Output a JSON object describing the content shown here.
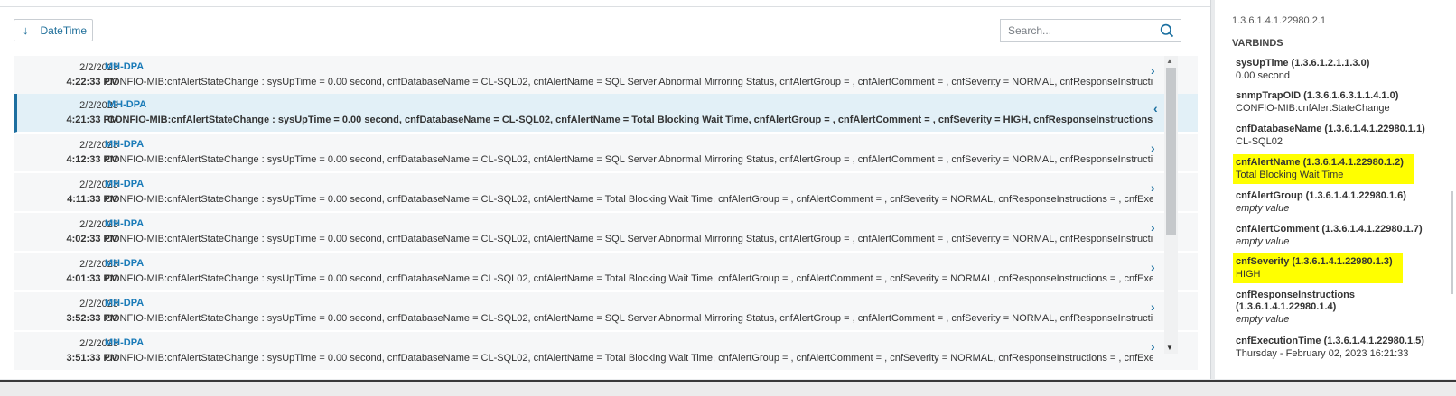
{
  "toolbar": {
    "sort_label": "DateTime",
    "sort_icon": "arrow-down-icon",
    "search_placeholder": "Search...",
    "search_icon": "search-icon"
  },
  "rows": [
    {
      "date": "2/2/2023",
      "time": "4:22:33 PM",
      "source": "MH-DPA",
      "message": "CONFIO-MIB:cnfAlertStateChange : sysUpTime = 0.00 second, cnfDatabaseName = CL-SQL02, cnfAlertName = SQL Server Abnormal Mirroring Status, cnfAlertGroup = , cnfAlertComment = , cnfSeverity = NORMAL, cnfResponseInstructions",
      "chevron": "›",
      "selected": false
    },
    {
      "date": "2/2/2023",
      "time": "4:21:33 PM",
      "source": "MH-DPA",
      "message": "CONFIO-MIB:cnfAlertStateChange : sysUpTime = 0.00 second, cnfDatabaseName = CL-SQL02, cnfAlertName = Total Blocking Wait Time, cnfAlertGroup = , cnfAlertComment = , cnfSeverity = HIGH, cnfResponseInstructions = ,",
      "chevron": "‹",
      "selected": true
    },
    {
      "date": "2/2/2023",
      "time": "4:12:33 PM",
      "source": "MH-DPA",
      "message": "CONFIO-MIB:cnfAlertStateChange : sysUpTime = 0.00 second, cnfDatabaseName = CL-SQL02, cnfAlertName = SQL Server Abnormal Mirroring Status, cnfAlertGroup = , cnfAlertComment = , cnfSeverity = NORMAL, cnfResponseInstructions",
      "chevron": "›",
      "selected": false
    },
    {
      "date": "2/2/2023",
      "time": "4:11:33 PM",
      "source": "MH-DPA",
      "message": "CONFIO-MIB:cnfAlertStateChange : sysUpTime = 0.00 second, cnfDatabaseName = CL-SQL02, cnfAlertName = Total Blocking Wait Time, cnfAlertGroup = , cnfAlertComment = , cnfSeverity = NORMAL, cnfResponseInstructions = , cnfExecutio",
      "chevron": "›",
      "selected": false
    },
    {
      "date": "2/2/2023",
      "time": "4:02:33 PM",
      "source": "MH-DPA",
      "message": "CONFIO-MIB:cnfAlertStateChange : sysUpTime = 0.00 second, cnfDatabaseName = CL-SQL02, cnfAlertName = SQL Server Abnormal Mirroring Status, cnfAlertGroup = , cnfAlertComment = , cnfSeverity = NORMAL, cnfResponseInstructions",
      "chevron": "›",
      "selected": false
    },
    {
      "date": "2/2/2023",
      "time": "4:01:33 PM",
      "source": "MH-DPA",
      "message": "CONFIO-MIB:cnfAlertStateChange : sysUpTime = 0.00 second, cnfDatabaseName = CL-SQL02, cnfAlertName = Total Blocking Wait Time, cnfAlertGroup = , cnfAlertComment = , cnfSeverity = NORMAL, cnfResponseInstructions = , cnfExecutio",
      "chevron": "›",
      "selected": false
    },
    {
      "date": "2/2/2023",
      "time": "3:52:33 PM",
      "source": "MH-DPA",
      "message": "CONFIO-MIB:cnfAlertStateChange : sysUpTime = 0.00 second, cnfDatabaseName = CL-SQL02, cnfAlertName = SQL Server Abnormal Mirroring Status, cnfAlertGroup = , cnfAlertComment = , cnfSeverity = NORMAL, cnfResponseInstructions",
      "chevron": "›",
      "selected": false
    },
    {
      "date": "2/2/2023",
      "time": "3:51:33 PM",
      "source": "MH-DPA",
      "message": "CONFIO-MIB:cnfAlertStateChange : sysUpTime = 0.00 second, cnfDatabaseName = CL-SQL02, cnfAlertName = Total Blocking Wait Time, cnfAlertGroup = , cnfAlertComment = , cnfSeverity = NORMAL, cnfResponseInstructions = , cnfExecutio",
      "chevron": "›",
      "selected": false
    }
  ],
  "details": {
    "oid_partial": "1.3.6.1.4.1.22980.2.1",
    "varbinds_heading": "VARBINDS",
    "varbinds": [
      {
        "name": "sysUpTime (1.3.6.1.2.1.1.3.0)",
        "value": "0.00 second",
        "empty": false,
        "highlight": false
      },
      {
        "name": "snmpTrapOID (1.3.6.1.6.3.1.1.4.1.0)",
        "value": "CONFIO-MIB:cnfAlertStateChange",
        "empty": false,
        "highlight": false
      },
      {
        "name": "cnfDatabaseName (1.3.6.1.4.1.22980.1.1)",
        "value": "CL-SQL02",
        "empty": false,
        "highlight": false
      },
      {
        "name": "cnfAlertName (1.3.6.1.4.1.22980.1.2)",
        "value": "Total Blocking Wait Time",
        "empty": false,
        "highlight": true
      },
      {
        "name": "cnfAlertGroup (1.3.6.1.4.1.22980.1.6)",
        "value": "empty value",
        "empty": true,
        "highlight": false
      },
      {
        "name": "cnfAlertComment (1.3.6.1.4.1.22980.1.7)",
        "value": "empty value",
        "empty": true,
        "highlight": false
      },
      {
        "name": "cnfSeverity (1.3.6.1.4.1.22980.1.3)",
        "value": "HIGH",
        "empty": false,
        "highlight": true
      },
      {
        "name": "cnfResponseInstructions (1.3.6.1.4.1.22980.1.4)",
        "value": "empty value",
        "empty": true,
        "highlight": false
      },
      {
        "name": "cnfExecutionTime (1.3.6.1.4.1.22980.1.5)",
        "value": "Thursday - February 02, 2023 16:21:33",
        "empty": false,
        "highlight": false
      }
    ]
  },
  "colors": {
    "accent": "#1a7bb8",
    "selected_row": "#e2f0f7",
    "highlight": "#ffff00"
  }
}
